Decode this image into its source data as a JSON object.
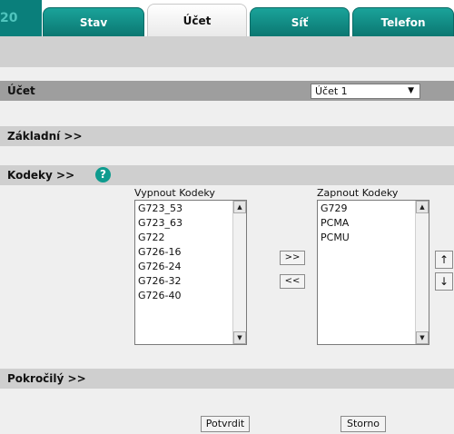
{
  "header": {
    "logo_number": "20",
    "tabs": [
      {
        "label": "Stav"
      },
      {
        "label": "Účet"
      },
      {
        "label": "Síť"
      },
      {
        "label": "Telefon"
      }
    ],
    "active_tab": "Účet"
  },
  "account": {
    "section_title": "Účet",
    "selected": "Účet 1"
  },
  "basic": {
    "section_title": "Základní >>"
  },
  "codecs": {
    "section_title": "Kodeky >>",
    "help_label": "?",
    "disabled_label": "Vypnout Kodeky",
    "disabled_items": [
      "G723_53",
      "G723_63",
      "G722",
      "G726-16",
      "G726-24",
      "G726-32",
      "G726-40"
    ],
    "enabled_label": "Zapnout Kodeky",
    "enabled_items": [
      "G729",
      "PCMA",
      "PCMU"
    ],
    "add_label": ">>",
    "remove_label": "<<",
    "up_label": "↑",
    "down_label": "↓"
  },
  "advanced": {
    "section_title": "Pokročilý >>"
  },
  "actions": {
    "confirm_label": "Potvrdit",
    "cancel_label": "Storno"
  },
  "colors": {
    "tab_teal": "#0b7771",
    "help_icon": "#0e9b8e",
    "section_dark": "#9e9e9e",
    "section_light": "#cfcfcf"
  }
}
